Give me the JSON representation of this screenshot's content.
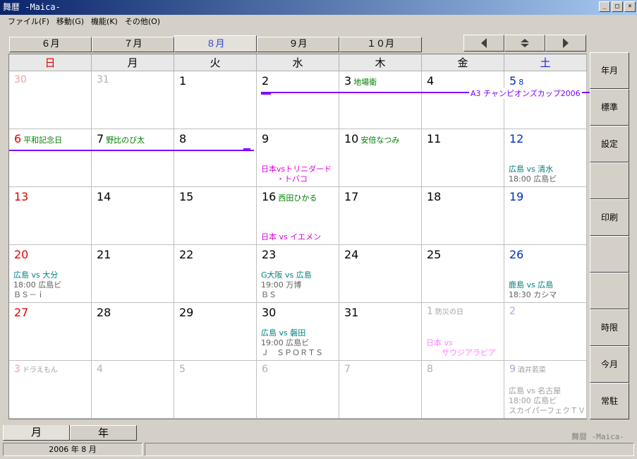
{
  "window": {
    "title": "舞暦 -Maica-",
    "btn_min": "_",
    "btn_max": "□",
    "btn_close": "×"
  },
  "menu": [
    "ファイル(F)",
    "移動(G)",
    "機能(K)",
    "その他(O)"
  ],
  "month_tabs": [
    "６月",
    "７月",
    "８月",
    "９月",
    "１０月"
  ],
  "weekdays": [
    "日",
    "月",
    "火",
    "水",
    "木",
    "金",
    "土"
  ],
  "weeks": [
    [
      {
        "n": "30",
        "out": true
      },
      {
        "n": "31",
        "out": true
      },
      {
        "n": "1"
      },
      {
        "n": "2"
      },
      {
        "n": "3",
        "hol": "地場衛"
      },
      {
        "n": "4"
      },
      {
        "n": "5",
        "hol": "8",
        "holblue": true
      }
    ],
    [
      {
        "n": "6",
        "hol": "平和記念日"
      },
      {
        "n": "7",
        "hol": "野比のび太"
      },
      {
        "n": "8"
      },
      {
        "n": "9",
        "ev": [
          {
            "t": "日本vsトリニダード",
            "c": "magenta",
            "y": 50
          },
          {
            "t": "　　・トバコ",
            "c": "magenta",
            "y": 64
          }
        ]
      },
      {
        "n": "10",
        "hol": "安倍なつみ"
      },
      {
        "n": "11"
      },
      {
        "n": "12",
        "ev": [
          {
            "t": "広島 vs 清水",
            "c": "teal",
            "y": 50
          },
          {
            "t": "18:00 広島ビ",
            "c": "gray",
            "y": 64
          }
        ]
      }
    ],
    [
      {
        "n": "13"
      },
      {
        "n": "14"
      },
      {
        "n": "15"
      },
      {
        "n": "16",
        "hol": "西田ひかる",
        "ev": [
          {
            "t": "日本 vs イエメン",
            "c": "magenta",
            "y": 64
          }
        ]
      },
      {
        "n": "17"
      },
      {
        "n": "18"
      },
      {
        "n": "19"
      }
    ],
    [
      {
        "n": "20",
        "ev": [
          {
            "t": "広島 vs 大分",
            "c": "teal",
            "y": 36
          },
          {
            "t": "18:00 広島ビ",
            "c": "gray",
            "y": 50
          },
          {
            "t": "ＢＳ－ｉ",
            "c": "gray",
            "y": 64
          }
        ]
      },
      {
        "n": "21"
      },
      {
        "n": "22"
      },
      {
        "n": "23",
        "ev": [
          {
            "t": "G大阪 vs 広島",
            "c": "teal",
            "y": 36
          },
          {
            "t": "19:00 万博",
            "c": "gray",
            "y": 50
          },
          {
            "t": "ＢＳ",
            "c": "gray",
            "y": 64
          }
        ]
      },
      {
        "n": "24"
      },
      {
        "n": "25"
      },
      {
        "n": "26",
        "ev": [
          {
            "t": "鹿島 vs 広島",
            "c": "teal",
            "y": 50
          },
          {
            "t": "18:30 カシマ",
            "c": "gray",
            "y": 64
          }
        ]
      }
    ],
    [
      {
        "n": "27"
      },
      {
        "n": "28"
      },
      {
        "n": "29"
      },
      {
        "n": "30",
        "ev": [
          {
            "t": "広島 vs 磐田",
            "c": "teal",
            "y": 36
          },
          {
            "t": "19:00 広島ビ",
            "c": "gray",
            "y": 50
          },
          {
            "t": "Ｊ　ＳＰＯＲＴＳ",
            "c": "gray",
            "y": 64
          }
        ]
      },
      {
        "n": "31"
      },
      {
        "n": "1",
        "out": true,
        "hol": "防災の日",
        "ev": [
          {
            "t": "日本 vs",
            "c": "lightmag",
            "y": 50
          },
          {
            "t": "　　サウジアラビア",
            "c": "lightmag",
            "y": 64
          }
        ]
      },
      {
        "n": "2",
        "out": true
      }
    ],
    [
      {
        "n": "3",
        "out": true,
        "hol": "ドラえもん"
      },
      {
        "n": "4",
        "out": true
      },
      {
        "n": "5",
        "out": true
      },
      {
        "n": "6",
        "out": true
      },
      {
        "n": "7",
        "out": true
      },
      {
        "n": "8",
        "out": true
      },
      {
        "n": "9",
        "out": true,
        "hol": "酒井若菜",
        "ev": [
          {
            "t": "広島 vs 名古屋",
            "c": "lightgray",
            "y": 36
          },
          {
            "t": "18:00 広島ビ",
            "c": "lightgray",
            "y": 50
          },
          {
            "t": "スカイパーフェクＴＶ",
            "c": "lightgray",
            "y": 64
          }
        ]
      }
    ]
  ],
  "banner_event": "A3 チャンピオンズカップ2006",
  "side_buttons": [
    "年月",
    "標準",
    "設定",
    "",
    "印刷",
    "",
    "",
    "時限",
    "今月",
    "常駐"
  ],
  "bottom_tabs": [
    "月",
    "年"
  ],
  "app_name": "舞暦 -Maica-",
  "status": {
    "date": "2006 年 8 月",
    "message": ""
  },
  "colors": {
    "sunday": "#e00000",
    "saturday": "#0030c0",
    "event_bar": "#8000ff",
    "holiday": "#008000"
  }
}
